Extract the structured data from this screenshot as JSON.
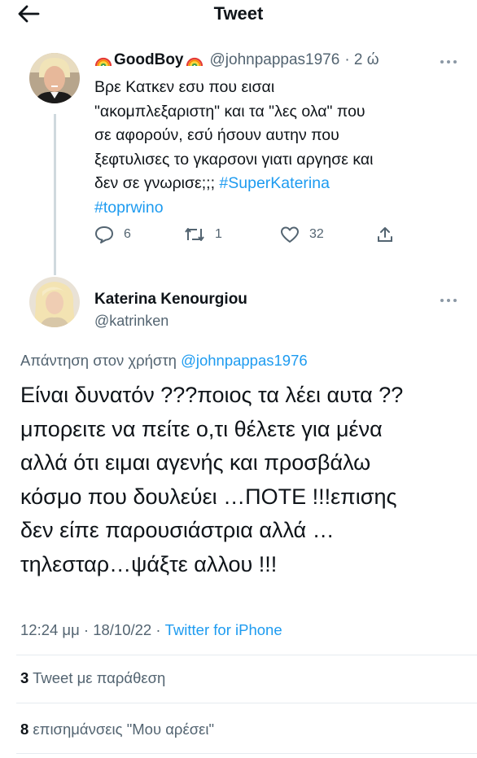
{
  "header": {
    "title": "Tweet",
    "back_icon": "arrow-left-icon"
  },
  "parent_tweet": {
    "display_name": "GoodBoy",
    "name_emoji": "rainbow-icon",
    "handle": "@johnpappas1976",
    "time": "· 2 ώ",
    "text_lines": [
      "Βρε Κατκεν εσυ που εισαι",
      "\"ακομπλεξαριστη\" και τα \"λες ολα\" που",
      "σε αφορούν, εσύ ήσουν αυτην που",
      "ξεφτυλισες το γκαρσονι γιατι αργησε και",
      "δεν σε γνωρισε;;; "
    ],
    "hashtag_1": "#SuperKaterina",
    "hashtag_2": "#toprwino",
    "reply_count": "6",
    "retweet_count": "1",
    "like_count": "32"
  },
  "reply_tweet": {
    "display_name": "Katerina Kenourgiou",
    "handle": "@katrinken",
    "replying_prefix": "Απάντηση στον χρήστη ",
    "replying_mention": "@johnpappas1976",
    "text_lines": [
      "Είναι δυνατόν ???ποιος τα λέει αυτα ??",
      "μπορειτε να πείτε ο,τι θέλετε για μένα",
      "αλλά ότι ειμαι αγενής και προσβάλω",
      "κόσμο που δουλεύει …ΠΟΤΕ !!!επισης",
      "δεν είπε παρουσιάστρια αλλά …",
      "τηλεσταρ…ψάξτε αλλου !!!"
    ],
    "timestamp": "12:24 μμ · 18/10/22 · ",
    "source": "Twitter for iPhone"
  },
  "stats": {
    "quote_count": "3",
    "quote_label": " Tweet με παράθεση",
    "like_count": "8",
    "like_label": " επισημάνσεις \"Μου αρέσει\""
  },
  "colors": {
    "link": "#1d9bf0",
    "muted": "#536471",
    "text": "#0f1419"
  }
}
